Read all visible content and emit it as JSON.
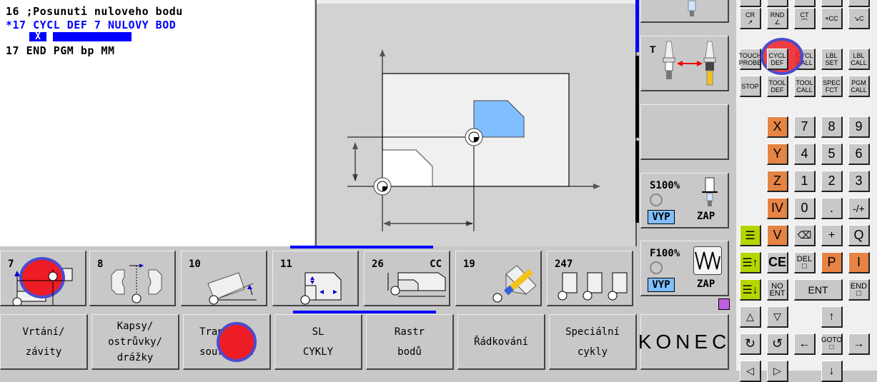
{
  "editor": {
    "lines": [
      {
        "text": "16 ;Posunuti nuloveho bodu",
        "active": false
      },
      {
        "text": "*17 CYCL DEF 7 NULOVY BOD",
        "active": true
      },
      {
        "text": "17 END PGM bp MM",
        "active": false
      }
    ],
    "input_axis": "X"
  },
  "help_graphic": {
    "name": "zero-point-shift-diagram"
  },
  "side_softkeys": {
    "tool_change_label": "T",
    "spindle": {
      "override": "S100%",
      "off_label": "VYP",
      "on_label": "ZAP"
    },
    "feed": {
      "override": "F100%",
      "off_label": "VYP",
      "on_label": "ZAP"
    }
  },
  "cycle_softkeys": [
    {
      "number": "7",
      "extra": ""
    },
    {
      "number": "8",
      "extra": ""
    },
    {
      "number": "10",
      "extra": ""
    },
    {
      "number": "11",
      "extra": ""
    },
    {
      "number": "26",
      "extra": "CC"
    },
    {
      "number": "19",
      "extra": ""
    },
    {
      "number": "247",
      "extra": ""
    }
  ],
  "bottom_softkeys": [
    {
      "lines": [
        "Vrtání/",
        "závity"
      ]
    },
    {
      "lines": [
        "Kapsy/",
        "ostrůvky/",
        "drážky"
      ]
    },
    {
      "lines": [
        "Transfor.",
        "souřadnic"
      ]
    },
    {
      "lines": [
        "SL",
        "CYKLY"
      ]
    },
    {
      "lines": [
        "Rastr",
        "bodů"
      ]
    },
    {
      "lines": [
        "Řádkování"
      ]
    },
    {
      "lines": [
        "Speciální",
        "cykly"
      ]
    }
  ],
  "end_softkey": "KONEC",
  "keyboard": {
    "path_keys": [
      "CR",
      "RND",
      "CT",
      "CC",
      "C"
    ],
    "prog_keys_row1": [
      [
        "TOUCH",
        "PROBE"
      ],
      [
        "CYCL",
        "DEF"
      ],
      [
        "CYCL",
        "CALL"
      ],
      [
        "LBL",
        "SET"
      ],
      [
        "LBL",
        "CALL"
      ]
    ],
    "prog_keys_row2": [
      [
        "STOP"
      ],
      [
        "TOOL",
        "DEF"
      ],
      [
        "TOOL",
        "CALL"
      ],
      [
        "SPEC",
        "FCT"
      ],
      [
        "PGM",
        "CALL"
      ]
    ],
    "axis_keys": [
      "X",
      "Y",
      "Z",
      "IV",
      "V"
    ],
    "num_rows": [
      [
        "7",
        "8",
        "9"
      ],
      [
        "4",
        "5",
        "6"
      ],
      [
        "1",
        "2",
        "3"
      ],
      [
        "0",
        ".",
        "-/+"
      ]
    ],
    "row_v": [
      "⌫",
      "+",
      "Q"
    ],
    "ce_label": "CE",
    "del_label": "DEL",
    "p_label": "P",
    "i_label": "I",
    "no_ent_label": [
      "NO",
      "ENT"
    ],
    "ent_label": "ENT",
    "end_label": "END",
    "goto_label": "GOTO"
  },
  "colors": {
    "accent_blue": "#0000ff",
    "axis_key_orange": "#e58444",
    "lime_key": "#b5d400",
    "highlight_red": "#ee1c24",
    "highlight_ring": "#4b4bd0",
    "part_blue": "#80bfff"
  }
}
